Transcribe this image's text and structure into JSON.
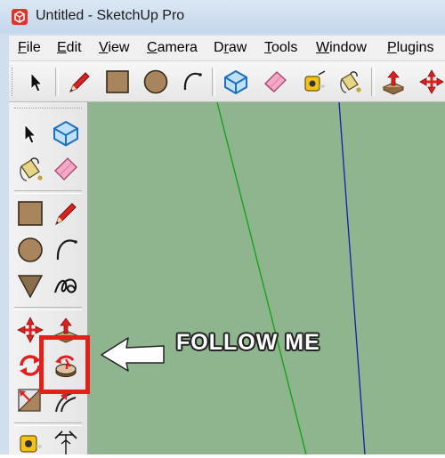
{
  "window": {
    "title": "Untitled - SketchUp Pro",
    "app_icon": "sketchup-logo-icon"
  },
  "menubar": {
    "items": [
      {
        "label_ul": "F",
        "label_rest": "ile"
      },
      {
        "label_ul": "E",
        "label_rest": "dit"
      },
      {
        "label_ul": "V",
        "label_rest": "iew"
      },
      {
        "label_ul": "C",
        "label_rest": "amera"
      },
      {
        "label_pre": "D",
        "label_ul": "r",
        "label_rest": "aw"
      },
      {
        "label_ul": "T",
        "label_rest": "ools"
      },
      {
        "label_ul": "W",
        "label_rest": "indow"
      },
      {
        "label_ul": "P",
        "label_rest": "lugins"
      }
    ]
  },
  "top_toolbar": {
    "tools": [
      "select-icon",
      "pencil-line-icon",
      "rectangle-icon",
      "circle-icon",
      "arc-icon",
      "make-component-icon",
      "eraser-icon",
      "tape-measure-icon",
      "paint-bucket-icon",
      "push-pull-icon",
      "move-icon"
    ]
  },
  "left_toolbar": {
    "tools": [
      "select-icon",
      "make-component-icon",
      "paint-bucket-icon",
      "eraser-icon",
      "rectangle-icon",
      "pencil-line-icon",
      "circle-icon",
      "arc-icon",
      "polygon-icon",
      "freehand-icon",
      "move-icon",
      "push-pull-icon",
      "rotate-icon",
      "follow-me-icon",
      "scale-icon",
      "offset-icon",
      "tape-measure-icon",
      "dimension-icon"
    ]
  },
  "canvas": {
    "background": "#8fb58f",
    "green_axis_color": "#10a010",
    "blue_axis_color": "#1a1aa8"
  },
  "annotation": {
    "label": "FOLLOW ME",
    "box_color": "#e0211c",
    "arrow_color": "#ffffff"
  }
}
